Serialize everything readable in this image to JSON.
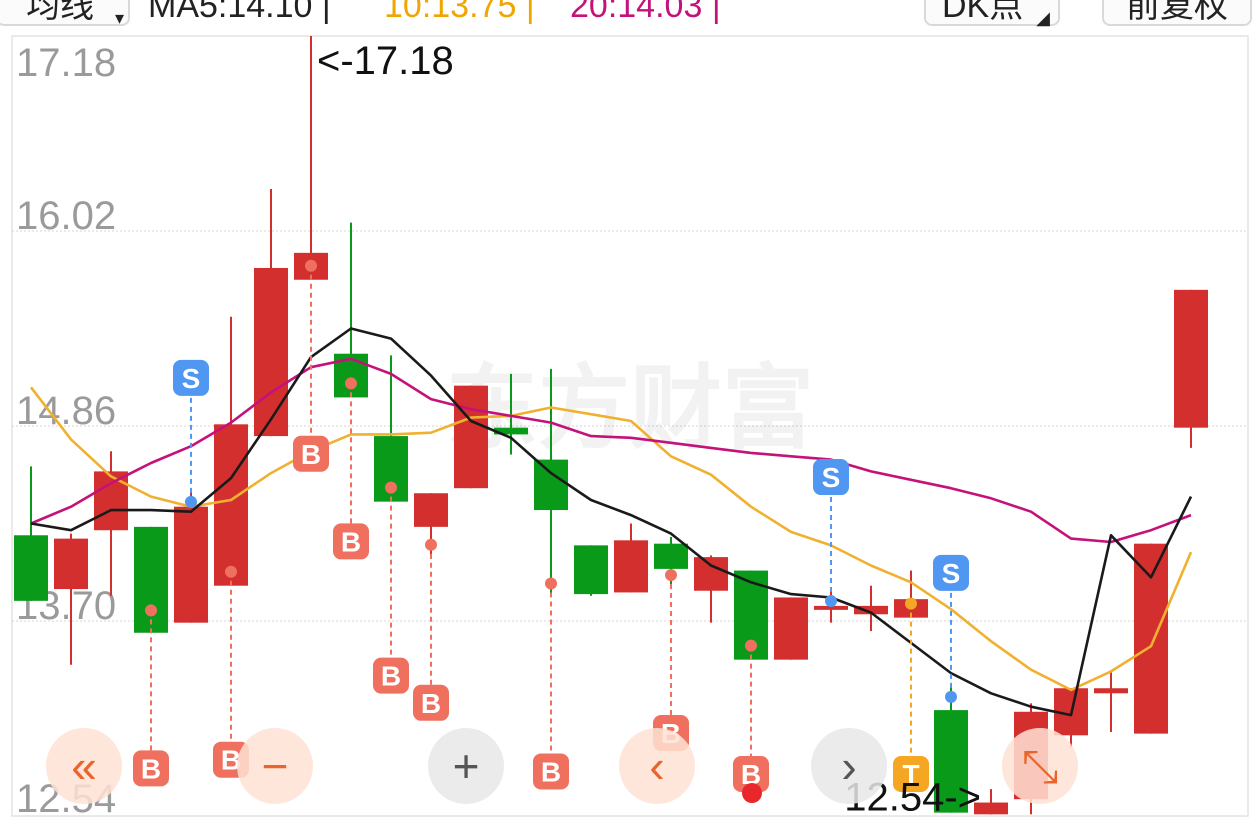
{
  "toolbar": {
    "indicator_label": "均线",
    "ma5_label": "MA5:14.10",
    "ma10_label": "10:13.75",
    "ma20_label": "20:14.03",
    "separator": "|",
    "dk_label": "DK点",
    "adjust_label": "前复权"
  },
  "watermark": "东方财富",
  "colors": {
    "up": "#d32f2f",
    "down": "#0a9a1a",
    "ma5": "#1a1a1a",
    "ma10": "#f0b030",
    "ma20": "#c4127a",
    "buy_marker": "#f07060",
    "sell_marker": "#4f97f0",
    "t_marker": "#f5a623"
  },
  "chart_data": {
    "type": "candlestick",
    "y_axis_ticks": [
      "17.18",
      "16.02",
      "14.86",
      "13.70",
      "12.54"
    ],
    "ylim": [
      12.54,
      17.18
    ],
    "grid": true,
    "candles": [
      {
        "o": 14.21,
        "h": 14.62,
        "l": 13.82,
        "c": 13.82
      },
      {
        "o": 13.89,
        "h": 14.22,
        "l": 13.44,
        "c": 14.19
      },
      {
        "o": 14.24,
        "h": 14.71,
        "l": 13.85,
        "c": 14.59
      },
      {
        "o": 14.26,
        "h": 14.26,
        "l": 13.68,
        "c": 13.63
      },
      {
        "o": 13.69,
        "h": 14.48,
        "l": 13.69,
        "c": 14.38
      },
      {
        "o": 13.91,
        "h": 15.51,
        "l": 13.91,
        "c": 14.87
      },
      {
        "o": 14.8,
        "h": 16.27,
        "l": 14.8,
        "c": 15.8
      },
      {
        "o": 15.73,
        "h": 17.18,
        "l": 15.73,
        "c": 15.89
      },
      {
        "o": 15.29,
        "h": 16.07,
        "l": 15.03,
        "c": 15.03
      },
      {
        "o": 14.8,
        "h": 15.28,
        "l": 14.41,
        "c": 14.41
      },
      {
        "o": 14.26,
        "h": 14.46,
        "l": 14.07,
        "c": 14.46
      },
      {
        "o": 14.49,
        "h": 15.1,
        "l": 14.49,
        "c": 15.1
      },
      {
        "o": 14.85,
        "h": 15.17,
        "l": 14.69,
        "c": 14.81
      },
      {
        "o": 14.66,
        "h": 15.2,
        "l": 13.84,
        "c": 14.36
      },
      {
        "o": 14.15,
        "h": 14.15,
        "l": 13.85,
        "c": 13.86
      },
      {
        "o": 13.87,
        "h": 14.28,
        "l": 13.87,
        "c": 14.18
      },
      {
        "o": 14.16,
        "h": 14.2,
        "l": 13.89,
        "c": 14.01
      },
      {
        "o": 13.88,
        "h": 14.09,
        "l": 13.69,
        "c": 14.08
      },
      {
        "o": 14.0,
        "h": 14.0,
        "l": 13.47,
        "c": 13.47
      },
      {
        "o": 13.47,
        "h": 13.84,
        "l": 13.47,
        "c": 13.84
      },
      {
        "o": 13.77,
        "h": 13.89,
        "l": 13.69,
        "c": 13.79
      },
      {
        "o": 13.74,
        "h": 13.91,
        "l": 13.64,
        "c": 13.79
      },
      {
        "o": 13.72,
        "h": 14.0,
        "l": 13.72,
        "c": 13.83
      },
      {
        "o": 13.17,
        "h": 13.32,
        "l": 12.56,
        "c": 12.56
      },
      {
        "o": 12.55,
        "h": 12.7,
        "l": 12.55,
        "c": 12.62
      },
      {
        "o": 12.64,
        "h": 13.21,
        "l": 12.55,
        "c": 13.16
      },
      {
        "o": 13.02,
        "h": 13.3,
        "l": 12.95,
        "c": 13.3
      },
      {
        "o": 13.27,
        "h": 13.4,
        "l": 13.04,
        "c": 13.3
      },
      {
        "o": 13.03,
        "h": 14.16,
        "l": 13.03,
        "c": 14.16
      },
      {
        "o": 14.85,
        "h": 15.67,
        "l": 14.73,
        "c": 15.67
      }
    ],
    "ma5": [
      14.28,
      14.24,
      14.36,
      14.36,
      14.35,
      14.55,
      14.9,
      15.27,
      15.44,
      15.38,
      15.16,
      14.89,
      14.79,
      14.58,
      14.42,
      14.33,
      14.22,
      14.03,
      13.93,
      13.86,
      13.84,
      13.75,
      13.57,
      13.39,
      13.27,
      13.19,
      13.14,
      14.21,
      13.96,
      14.44
    ],
    "ma10": [
      15.09,
      14.78,
      14.56,
      14.44,
      14.38,
      14.42,
      14.58,
      14.71,
      14.81,
      14.81,
      14.82,
      14.91,
      14.92,
      14.97,
      14.93,
      14.89,
      14.68,
      14.57,
      14.38,
      14.23,
      14.15,
      14.03,
      13.93,
      13.77,
      13.58,
      13.41,
      13.29,
      13.4,
      13.55,
      14.11
    ],
    "ma20": [
      14.28,
      14.38,
      14.52,
      14.64,
      14.74,
      14.88,
      15.06,
      15.21,
      15.26,
      15.17,
      15.02,
      14.96,
      14.92,
      14.88,
      14.8,
      14.79,
      14.76,
      14.73,
      14.7,
      14.68,
      14.66,
      14.59,
      14.54,
      14.49,
      14.43,
      14.35,
      14.19,
      14.17,
      14.24,
      14.33
    ],
    "price_labels": {
      "high": "<-17.18",
      "low": "12.54->"
    },
    "signals": [
      {
        "i": 3,
        "t": "B"
      },
      {
        "i": 5,
        "t": "B"
      },
      {
        "i": 4,
        "t": "S"
      },
      {
        "i": 7,
        "t": "B"
      },
      {
        "i": 8,
        "t": "B"
      },
      {
        "i": 9,
        "t": "B"
      },
      {
        "i": 10,
        "t": "B"
      },
      {
        "i": 13,
        "t": "B"
      },
      {
        "i": 16,
        "t": "B"
      },
      {
        "i": 18,
        "t": "B"
      },
      {
        "i": 20,
        "t": "S"
      },
      {
        "i": 22,
        "t": "T"
      },
      {
        "i": 23,
        "t": "S"
      }
    ]
  },
  "controls": {
    "rewind_icon": "«",
    "zoom_out_icon": "−",
    "zoom_in_icon": "+",
    "prev_icon": "‹",
    "next_icon": "›",
    "expand_icon": "⤡"
  }
}
